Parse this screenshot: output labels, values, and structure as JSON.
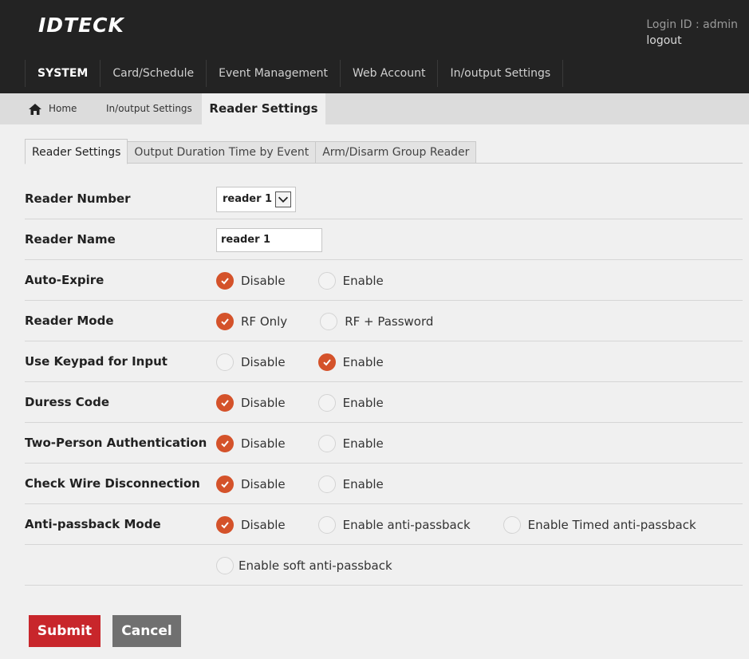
{
  "header": {
    "logo": "IDTECK",
    "login_text": "Login ID : admin",
    "logout": "logout"
  },
  "nav": [
    {
      "label": "SYSTEM",
      "active": true
    },
    {
      "label": "Card/Schedule"
    },
    {
      "label": "Event Management"
    },
    {
      "label": "Web Account"
    },
    {
      "label": "In/output Settings"
    }
  ],
  "breadcrumb": {
    "home_icon": "home-icon",
    "home": "Home",
    "section": "In/output Settings",
    "current": "Reader Settings"
  },
  "tabs": [
    {
      "label": "Reader Settings",
      "active": true
    },
    {
      "label": "Output Duration Time by Event"
    },
    {
      "label": "Arm/Disarm Group Reader"
    }
  ],
  "form": {
    "reader_number": {
      "label": "Reader Number",
      "value": "reader 1"
    },
    "reader_name": {
      "label": "Reader Name",
      "value": "reader 1"
    },
    "auto_expire": {
      "label": "Auto-Expire",
      "options": [
        "Disable",
        "Enable"
      ],
      "selected": 0
    },
    "reader_mode": {
      "label": "Reader Mode",
      "options": [
        "RF Only",
        "RF + Password"
      ],
      "selected": 0
    },
    "keypad": {
      "label": "Use Keypad for Input",
      "options": [
        "Disable",
        "Enable"
      ],
      "selected": 1
    },
    "duress": {
      "label": "Duress Code",
      "options": [
        "Disable",
        "Enable"
      ],
      "selected": 0
    },
    "two_person": {
      "label": "Two-Person Authentication",
      "options": [
        "Disable",
        "Enable"
      ],
      "selected": 0
    },
    "wire": {
      "label": "Check Wire Disconnection",
      "options": [
        "Disable",
        "Enable"
      ],
      "selected": 0
    },
    "anti_passback": {
      "label": "Anti-passback Mode",
      "options": [
        "Disable",
        "Enable anti-passback",
        "Enable Timed anti-passback",
        "Enable soft anti-passback"
      ],
      "selected": 0
    }
  },
  "buttons": {
    "submit": "Submit",
    "cancel": "Cancel"
  },
  "colors": {
    "accent": "#d4522a",
    "submit": "#c8262b",
    "cancel": "#707070",
    "header": "#232323"
  }
}
